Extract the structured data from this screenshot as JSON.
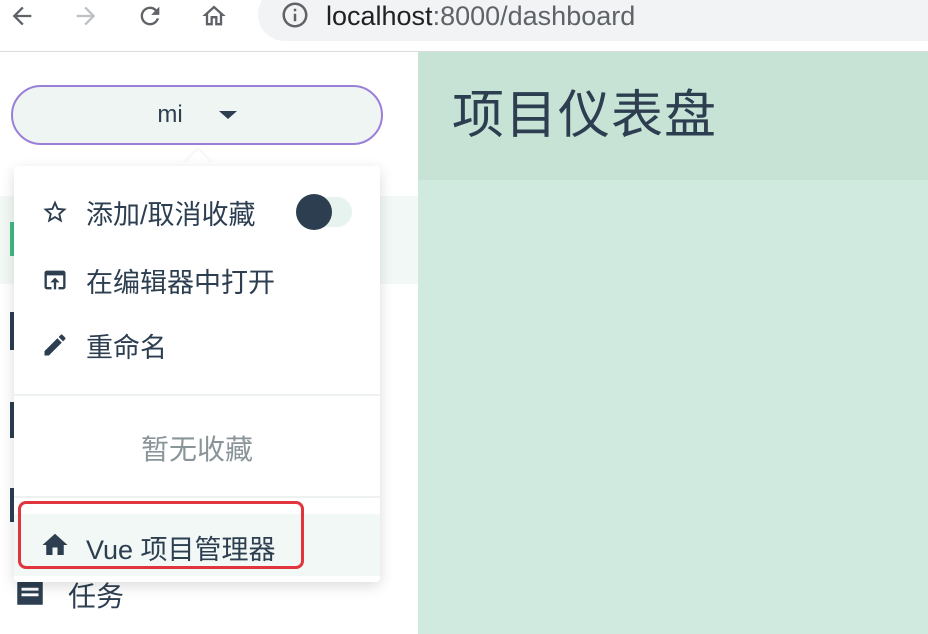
{
  "browser": {
    "back_icon": "arrow-left-icon",
    "forward_icon": "arrow-right-icon",
    "reload_icon": "reload-icon",
    "home_icon": "home-icon",
    "site_info_icon": "info-circle-icon",
    "url_host": "localhost",
    "url_path": ":8000/dashboard"
  },
  "main": {
    "title": "项目仪表盘"
  },
  "sidebar": {
    "project_select": {
      "current": "mi",
      "caret_icon": "caret-down-icon"
    },
    "partial_item_label": "任务"
  },
  "project_menu": {
    "items": [
      {
        "label": "添加/取消收藏",
        "icon": "star-outline-icon",
        "toggle_on": false
      },
      {
        "label": "在编辑器中打开",
        "icon": "open-in-browser-icon"
      },
      {
        "label": "重命名",
        "icon": "pencil-icon"
      }
    ],
    "favorites_empty": "暂无收藏",
    "home_item": {
      "label": "Vue 项目管理器",
      "icon": "home-icon"
    }
  },
  "colors": {
    "text_primary": "#2c3e50",
    "main_bg": "#d1eadf",
    "main_header_bg": "#c6e3d6",
    "select_border": "#9a7fd8",
    "highlight_red": "#e0353c",
    "accent_green": "#42b983"
  }
}
